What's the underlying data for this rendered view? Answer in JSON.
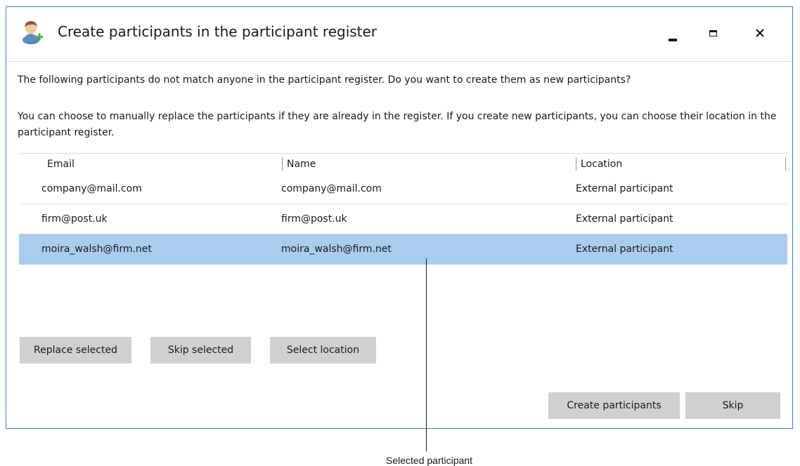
{
  "window": {
    "title": "Create participants in the participant register",
    "icon": "add-user-icon"
  },
  "messages": {
    "intro": "The following participants do not match anyone in the participant register. Do you want to create them as new participants?",
    "details": "You can choose to manually replace the participants if they are already in the register. If you create new participants, you can choose their location in the participant register."
  },
  "table": {
    "columns": [
      "Email",
      "Name",
      "Location"
    ],
    "rows": [
      {
        "email": "company@mail.com",
        "name": "company@mail.com",
        "location": "External participant",
        "selected": false
      },
      {
        "email": "firm@post.uk",
        "name": "firm@post.uk",
        "location": "External participant",
        "selected": false
      },
      {
        "email": "moira_walsh@firm.net",
        "name": "moira_walsh@firm.net",
        "location": "External participant",
        "selected": true
      }
    ]
  },
  "actions": {
    "replace_selected": "Replace selected",
    "skip_selected": "Skip selected",
    "select_location": "Select location",
    "create_participants": "Create participants",
    "skip": "Skip"
  },
  "callout": {
    "label": "Selected participant"
  },
  "colors": {
    "window_border": "#3a7fd5",
    "selected_row": "#aacdee",
    "button_bg": "#d0d0d0"
  }
}
